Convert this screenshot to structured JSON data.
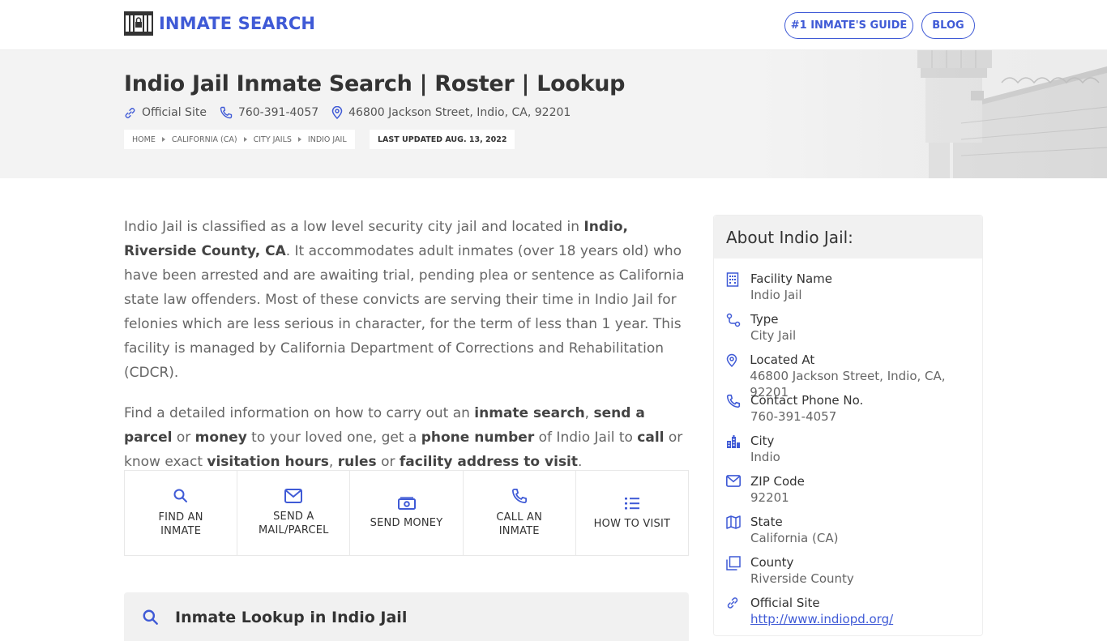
{
  "brand": {
    "name": "INMATE SEARCH"
  },
  "nav": {
    "guide_label": "#1 INMATE'S GUIDE",
    "blog_label": "BLOG"
  },
  "hero": {
    "title": "Indio Jail Inmate Search | Roster | Lookup",
    "official_site_label": "Official Site",
    "phone": "760-391-4057",
    "address": "46800 Jackson Street, Indio, CA, 92201",
    "breadcrumbs": [
      "HOME",
      "CALIFORNIA (CA)",
      "CITY JAILS",
      "INDIO JAIL"
    ],
    "last_updated": "LAST UPDATED AUG. 13, 2022"
  },
  "intro": {
    "p1_a": "Indio Jail is classified as a low level security city jail and located in ",
    "p1_b": "Indio, Riverside County, CA",
    "p1_c": ". It accommodates adult inmates (over 18 years old) who have been arrested and are awaiting trial, pending plea or sentence as California state law offenders. Most of these convicts are serving their time in Indio Jail for felonies which are less serious in character, for the term of less than 1 year. This facility is managed by California Department of Corrections and Rehabilitation (CDCR).",
    "p2_1": "Find a detailed information on how to carry out an ",
    "p2_2": "inmate search",
    "p2_3": ", ",
    "p2_4": "send a parcel",
    "p2_5": " or ",
    "p2_6": "money",
    "p2_7": " to your loved one, get a ",
    "p2_8": "phone number",
    "p2_9": " of Indio Jail to ",
    "p2_10": "call",
    "p2_11": " or know exact ",
    "p2_12": "visitation hours",
    "p2_13": ", ",
    "p2_14": "rules",
    "p2_15": " or ",
    "p2_16": "facility address to visit",
    "p2_17": "."
  },
  "actions": [
    {
      "label_1": "FIND AN",
      "label_2": "INMATE",
      "icon": "search-icon"
    },
    {
      "label_1": "SEND A",
      "label_2": "MAIL/PARCEL",
      "icon": "mail-icon"
    },
    {
      "label_1": "SEND MONEY",
      "label_2": "",
      "icon": "money-icon"
    },
    {
      "label_1": "CALL AN",
      "label_2": "INMATE",
      "icon": "phone-icon"
    },
    {
      "label_1": "HOW TO VISIT",
      "label_2": "",
      "icon": "list-icon"
    }
  ],
  "lookup": {
    "title": "Inmate Lookup in Indio Jail"
  },
  "about": {
    "title": "About Indio Jail:",
    "items": [
      {
        "key": "Facility Name",
        "value": "Indio Jail",
        "icon": "building-icon"
      },
      {
        "key": "Type",
        "value": "City Jail",
        "icon": "route-icon"
      },
      {
        "key": "Located At",
        "value": "46800 Jackson Street, Indio, CA, 92201",
        "icon": "location-pin-icon"
      },
      {
        "key": "Contact Phone No.",
        "value": "760-391-4057",
        "icon": "phone-icon"
      },
      {
        "key": "City",
        "value": "Indio",
        "icon": "city-icon"
      },
      {
        "key": "ZIP Code",
        "value": "92201",
        "icon": "mail-icon"
      },
      {
        "key": "State",
        "value": "California (CA)",
        "icon": "map-icon"
      },
      {
        "key": "County",
        "value": "Riverside County",
        "icon": "copy-icon"
      },
      {
        "key": "Official Site",
        "value": "http://www.indiopd.org/",
        "icon": "link-icon"
      }
    ]
  },
  "colors": {
    "accent": "#3f5ad6",
    "hero_bg": "#f3f3f3",
    "panel_bg": "#f1f1f1"
  }
}
